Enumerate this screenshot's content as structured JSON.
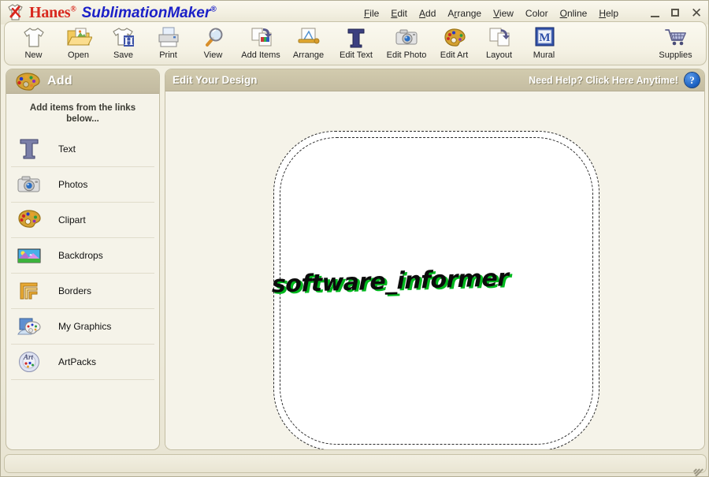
{
  "window": {
    "brand_name": "Hanes",
    "brand_mark": "®",
    "product_name": "SublimationMaker",
    "product_mark": "®",
    "logo_icon": "tshirt-brush-icon",
    "controls": {
      "minimize": "minimize-icon",
      "maximize": "maximize-icon",
      "close": "close-icon"
    }
  },
  "menubar": {
    "items": [
      {
        "label": "File",
        "accel": "F"
      },
      {
        "label": "Edit",
        "accel": "E"
      },
      {
        "label": "Add",
        "accel": "A"
      },
      {
        "label": "Arrange",
        "accel": "r"
      },
      {
        "label": "View",
        "accel": "V"
      },
      {
        "label": "Color",
        "accel": ""
      },
      {
        "label": "Online",
        "accel": "O"
      },
      {
        "label": "Help",
        "accel": "H"
      }
    ]
  },
  "toolbar": {
    "buttons": [
      {
        "label": "New",
        "icon": "tshirt-icon"
      },
      {
        "label": "Open",
        "icon": "open-folder-icon"
      },
      {
        "label": "Save",
        "icon": "save-tshirt-icon"
      },
      {
        "label": "Print",
        "icon": "printer-icon"
      },
      {
        "label": "View",
        "icon": "magnifier-icon"
      },
      {
        "label": "Add Items",
        "icon": "add-items-icon"
      },
      {
        "label": "Arrange",
        "icon": "arrange-icon"
      },
      {
        "label": "Edit Text",
        "icon": "text-t-icon"
      },
      {
        "label": "Edit Photo",
        "icon": "camera-icon"
      },
      {
        "label": "Edit Art",
        "icon": "palette-icon"
      },
      {
        "label": "Layout",
        "icon": "layout-pages-icon"
      },
      {
        "label": "Mural",
        "icon": "mural-m-icon"
      }
    ],
    "right_buttons": [
      {
        "label": "Supplies",
        "icon": "shopping-cart-icon"
      }
    ]
  },
  "sidebar": {
    "header_title": "Add",
    "header_icon": "palette-icon",
    "subtitle": "Add items from the links below...",
    "items": [
      {
        "label": "Text",
        "icon": "text-t-icon"
      },
      {
        "label": "Photos",
        "icon": "camera-icon"
      },
      {
        "label": "Clipart",
        "icon": "palette-icon"
      },
      {
        "label": "Backdrops",
        "icon": "landscape-picture-icon"
      },
      {
        "label": "Borders",
        "icon": "border-corner-icon"
      },
      {
        "label": "My Graphics",
        "icon": "my-graphics-icon"
      },
      {
        "label": "ArtPacks",
        "icon": "artpacks-disc-icon"
      }
    ]
  },
  "design": {
    "title": "Edit Your Design",
    "help_text": "Need Help?  Click Here Anytime!",
    "help_icon": "question-mark-icon",
    "canvas": {
      "shape": "rounded-shirt-area",
      "cut_line": "dashed",
      "safe_line": "dashed",
      "artwork": {
        "text": "software_informer",
        "style": "bold-italic-outline",
        "fill_color": "#00b81e",
        "outline_color": "#0b0b0b"
      }
    }
  },
  "statusbar": {
    "text": "",
    "resize_grip": "resize-grip-icon"
  },
  "colors": {
    "app_background": "#efecdd",
    "panel_background": "#f5f3e9",
    "panel_header": "#c5bda2",
    "brand_red": "#d8281e",
    "brand_blue": "#1b20c8",
    "accent_blue": "#1a5fc0"
  }
}
